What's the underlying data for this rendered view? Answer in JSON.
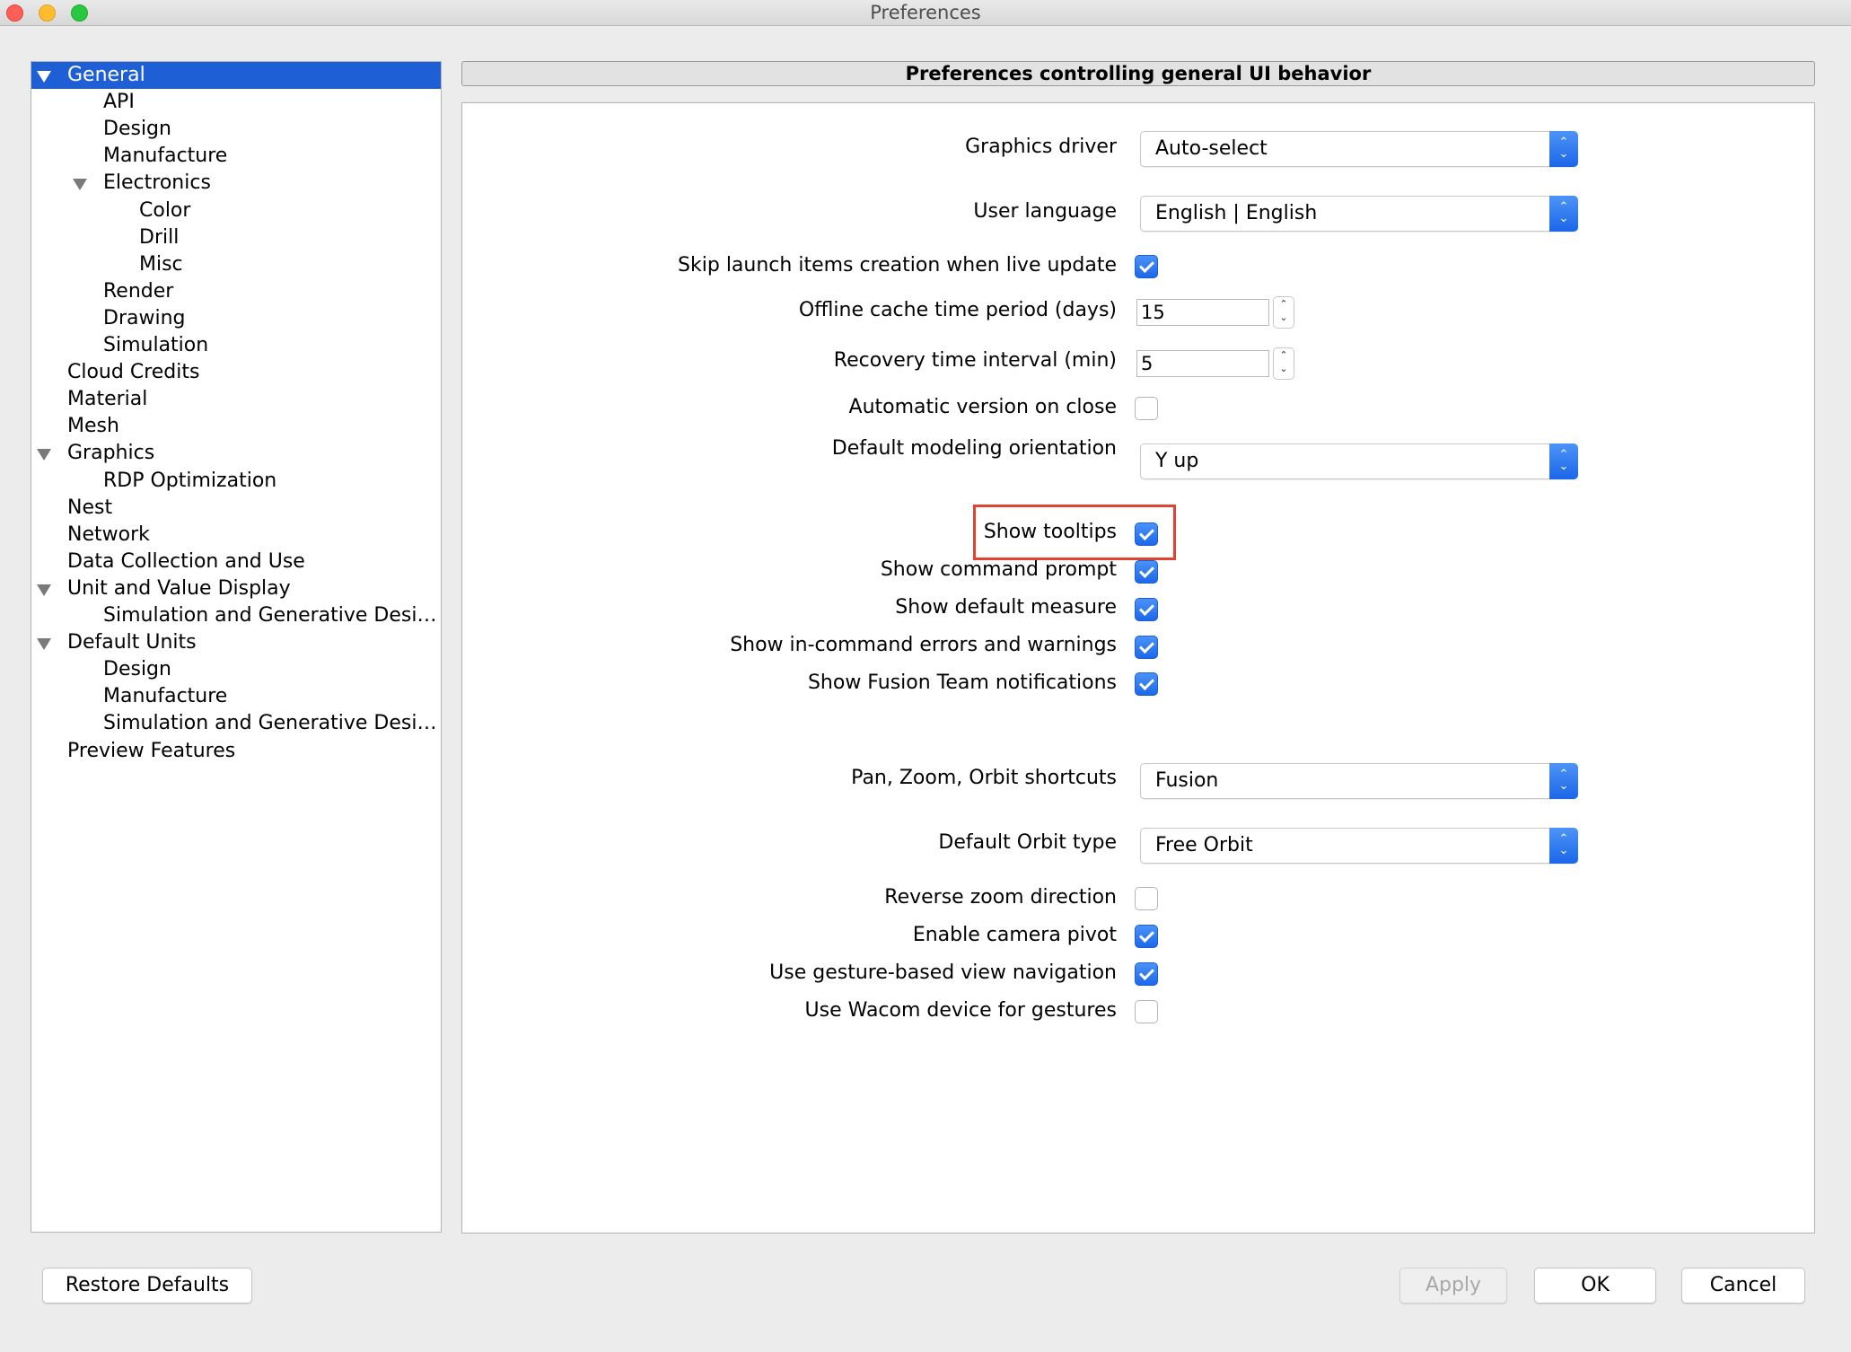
{
  "window": {
    "title": "Preferences"
  },
  "tree": [
    {
      "label": "General",
      "depth": 0,
      "expanded": true,
      "selected": true
    },
    {
      "label": "API",
      "depth": 1
    },
    {
      "label": "Design",
      "depth": 1
    },
    {
      "label": "Manufacture",
      "depth": 1
    },
    {
      "label": "Electronics",
      "depth": 1,
      "expanded": true
    },
    {
      "label": "Color",
      "depth": 2
    },
    {
      "label": "Drill",
      "depth": 2
    },
    {
      "label": "Misc",
      "depth": 2
    },
    {
      "label": "Render",
      "depth": 1
    },
    {
      "label": "Drawing",
      "depth": 1
    },
    {
      "label": "Simulation",
      "depth": 1
    },
    {
      "label": "Cloud Credits",
      "depth": 0
    },
    {
      "label": "Material",
      "depth": 0
    },
    {
      "label": "Mesh",
      "depth": 0
    },
    {
      "label": "Graphics",
      "depth": 0,
      "expanded": true
    },
    {
      "label": "RDP Optimization",
      "depth": 1
    },
    {
      "label": "Nest",
      "depth": 0
    },
    {
      "label": "Network",
      "depth": 0
    },
    {
      "label": "Data Collection and Use",
      "depth": 0
    },
    {
      "label": "Unit and Value Display",
      "depth": 0,
      "expanded": true
    },
    {
      "label": "Simulation and Generative Desi…",
      "depth": 1
    },
    {
      "label": "Default Units",
      "depth": 0,
      "expanded": true
    },
    {
      "label": "Design",
      "depth": 1
    },
    {
      "label": "Manufacture",
      "depth": 1
    },
    {
      "label": "Simulation and Generative Desi…",
      "depth": 1
    },
    {
      "label": "Preview Features",
      "depth": 0
    }
  ],
  "panel": {
    "header": "Preferences controlling general UI behavior",
    "graphics_driver": {
      "label": "Graphics driver",
      "value": "Auto-select"
    },
    "user_language": {
      "label": "User language",
      "value": "English | English"
    },
    "skip_launch": {
      "label": "Skip launch items creation when live update",
      "checked": true
    },
    "offline_cache": {
      "label": "Offline cache time period (days)",
      "value": "15"
    },
    "recovery_interval": {
      "label": "Recovery time interval (min)",
      "value": "5"
    },
    "auto_version": {
      "label": "Automatic version on close",
      "checked": false
    },
    "modeling_orientation": {
      "label": "Default modeling orientation",
      "value": "Y up"
    },
    "show_tooltips": {
      "label": "Show tooltips",
      "checked": true
    },
    "show_command_prompt": {
      "label": "Show command prompt",
      "checked": true
    },
    "show_default_measure": {
      "label": "Show default measure",
      "checked": true
    },
    "show_errors": {
      "label": "Show in-command errors and warnings",
      "checked": true
    },
    "show_team_notifications": {
      "label": "Show Fusion Team notifications",
      "checked": true
    },
    "pan_zoom_orbit": {
      "label": "Pan, Zoom, Orbit shortcuts",
      "value": "Fusion"
    },
    "orbit_type": {
      "label": "Default Orbit type",
      "value": "Free Orbit"
    },
    "reverse_zoom": {
      "label": "Reverse zoom direction",
      "checked": false
    },
    "camera_pivot": {
      "label": "Enable camera pivot",
      "checked": true
    },
    "gesture_nav": {
      "label": "Use gesture-based view navigation",
      "checked": true
    },
    "wacom": {
      "label": "Use Wacom device for gestures",
      "checked": false
    }
  },
  "footer": {
    "restore_defaults": "Restore Defaults",
    "apply": "Apply",
    "ok": "OK",
    "cancel": "Cancel"
  },
  "icons": {
    "up_down": "⌃⌄",
    "stepper_up": "⌃",
    "stepper_down": "⌄"
  },
  "colors": {
    "selection": "#1e5fd6",
    "accent": "#1d67ea",
    "highlight": "#e0432f"
  }
}
